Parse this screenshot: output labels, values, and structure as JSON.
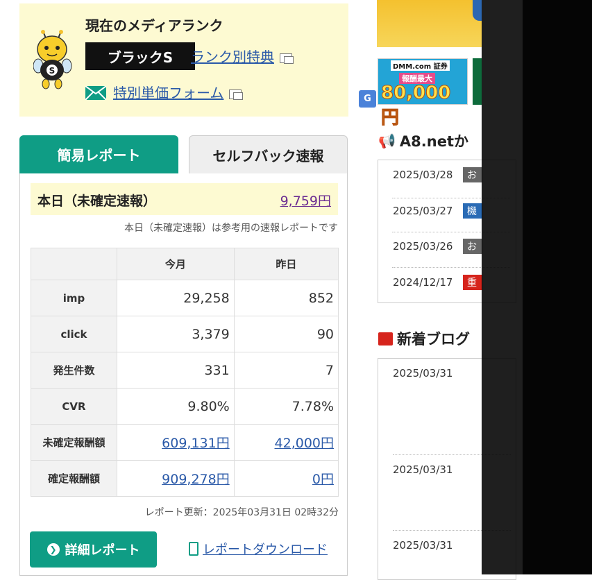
{
  "rank": {
    "title": "現在のメディアランク",
    "badge": "ブラックS",
    "rank_link": "ランク別特典",
    "special_link": "特別単価フォーム"
  },
  "tabs": {
    "active": "簡易レポート",
    "inactive": "セルフバック速報"
  },
  "today": {
    "label": "本日（未確定速報）",
    "value": "9,759円",
    "note": "本日（未確定速報）は参考用の速報レポートです"
  },
  "report": {
    "headers": [
      "",
      "今月",
      "昨日"
    ],
    "rows": [
      {
        "label": "imp",
        "month": "29,258",
        "yesterday": "852"
      },
      {
        "label": "click",
        "month": "3,379",
        "yesterday": "90"
      },
      {
        "label": "発生件数",
        "month": "331",
        "yesterday": "7"
      },
      {
        "label": "CVR",
        "month": "9.80%",
        "yesterday": "7.78%"
      },
      {
        "label": "未確定報酬額",
        "month": "609,131円",
        "yesterday": "42,000円"
      },
      {
        "label": "確定報酬額",
        "month": "909,278円",
        "yesterday": "0円"
      }
    ],
    "updated": "レポート更新：2025年03月31日 02時32分",
    "detail_button": "詳細レポート",
    "download_link": "レポートダウンロード"
  },
  "banners": {
    "dmm_logo": "DMM.com 証券",
    "dmm_sub": "報酬最大",
    "dmm_amount": "80,000円"
  },
  "news": {
    "heading": "A8.netか",
    "items": [
      {
        "date": "2025/03/28",
        "tag": "お",
        "tag_color": "#666666"
      },
      {
        "date": "2025/03/27",
        "tag": "機",
        "tag_color": "#2a6bb5"
      },
      {
        "date": "2025/03/26",
        "tag": "お",
        "tag_color": "#666666"
      },
      {
        "date": "2024/12/17",
        "tag": "重",
        "tag_color": "#d6241c"
      }
    ]
  },
  "blog": {
    "heading": "新着ブログ",
    "dates": [
      "2025/03/31",
      "2025/03/31",
      "2025/03/31"
    ]
  },
  "colors": {
    "accent": "#0f9d85",
    "rank_bg": "#fdfad2",
    "link": "#2a59a8"
  }
}
